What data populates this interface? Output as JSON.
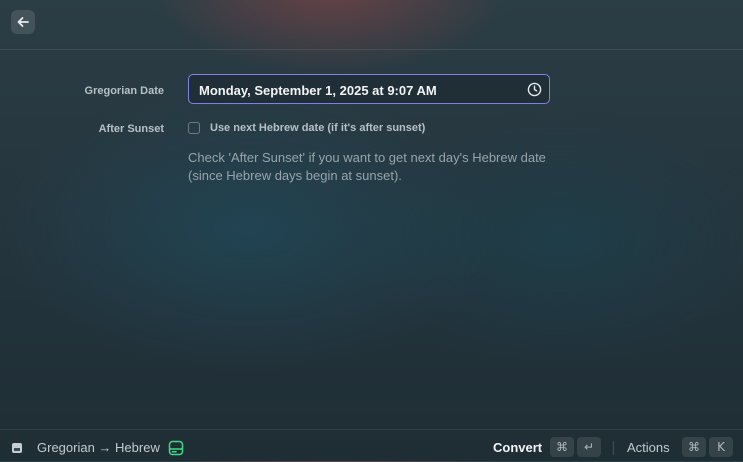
{
  "form": {
    "gregorian_label": "Gregorian Date",
    "gregorian_value": "Monday, September 1, 2025 at 9:07 AM",
    "after_sunset_label": "After Sunset",
    "after_sunset_checkbox_label": "Use next Hebrew date (if it's after sunset)",
    "after_sunset_checked": false,
    "help_text": "Check 'After Sunset' if you want to get next day's Hebrew date (since Hebrew days begin at sunset)."
  },
  "footer": {
    "title": "Gregorian → Hebrew",
    "primary_action": "Convert",
    "primary_shortcut": [
      "⌘",
      "↵"
    ],
    "secondary_action": "Actions",
    "secondary_shortcut": [
      "⌘",
      "K"
    ]
  },
  "colors": {
    "accent_border": "#7f7fe6",
    "hdd_icon": "#3ddc84"
  }
}
